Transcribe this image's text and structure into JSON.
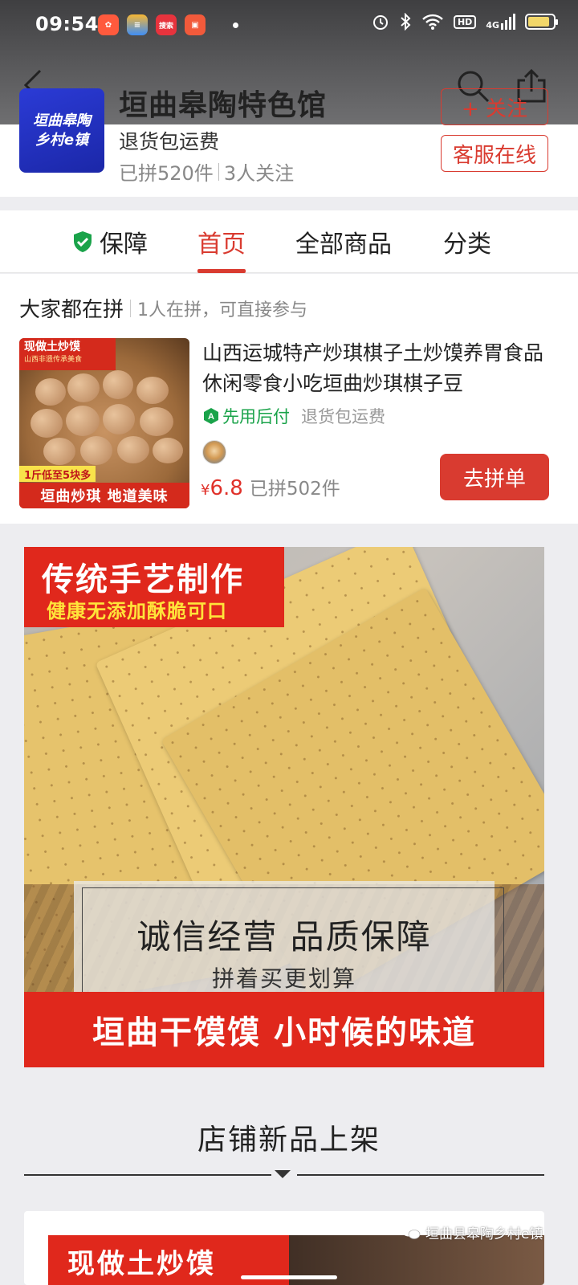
{
  "status_bar": {
    "time": "09:54",
    "apps": [
      {
        "icon": "app-icon-1",
        "label": "",
        "color": "#ff5a3d"
      },
      {
        "icon": "app-icon-2",
        "label": "",
        "color": "#3e8ef7"
      },
      {
        "icon": "app-icon-3",
        "label": "搜索",
        "color": "#e7333d"
      },
      {
        "icon": "app-icon-4",
        "label": "",
        "color": "#f25a3b"
      }
    ],
    "hd": "HD",
    "network": "4G",
    "battery_level": 0.85
  },
  "shop": {
    "logo_line1": "垣曲皋陶",
    "logo_line2": "乡村e镇",
    "name": "垣曲皋陶特色馆",
    "return_note": "退货包运费",
    "sold": "已拼520件",
    "followers": "3人关注",
    "follow_button": "+ 关注",
    "service_button": "客服在线"
  },
  "tabs": [
    {
      "label": "保障",
      "active": false
    },
    {
      "label": "首页",
      "active": true
    },
    {
      "label": "全部商品",
      "active": false
    },
    {
      "label": "分类",
      "active": false
    }
  ],
  "group": {
    "title": "大家都在拼",
    "subtitle": "1人在拼，可直接参与",
    "product": {
      "img_tag_top": "现做土炒馍",
      "img_tag_top_sub": "山西非遗传承美食",
      "img_tag_mid": "1斤低至5块多",
      "img_tag_bottom": "垣曲炒琪 地道美味",
      "title": "山西运城特产炒琪棋子土炒馍养胃食品休闲零食小吃垣曲炒琪棋子豆",
      "pay_later": "先用后付",
      "free_return": "退货包运费",
      "price_symbol": "¥",
      "price": "6.8",
      "sold": "已拼502件",
      "join_button": "去拼单"
    }
  },
  "banner": {
    "title": "传统手艺制作",
    "subtitle": "健康无添加酥脆可口",
    "box_title": "诚信经营 品质保障",
    "box_subtitle": "拼着买更划算",
    "footer": "垣曲干馍馍  小时候的味道"
  },
  "new_arrivals": {
    "title": "店铺新品上架",
    "card_text": "现做土炒馍"
  },
  "watermark": "垣曲县皋陶乡村e镇",
  "colors": {
    "accent": "#d93b30",
    "price": "#e0312a",
    "pay_later": "#1aa34a",
    "banner_red": "#e0281c"
  }
}
